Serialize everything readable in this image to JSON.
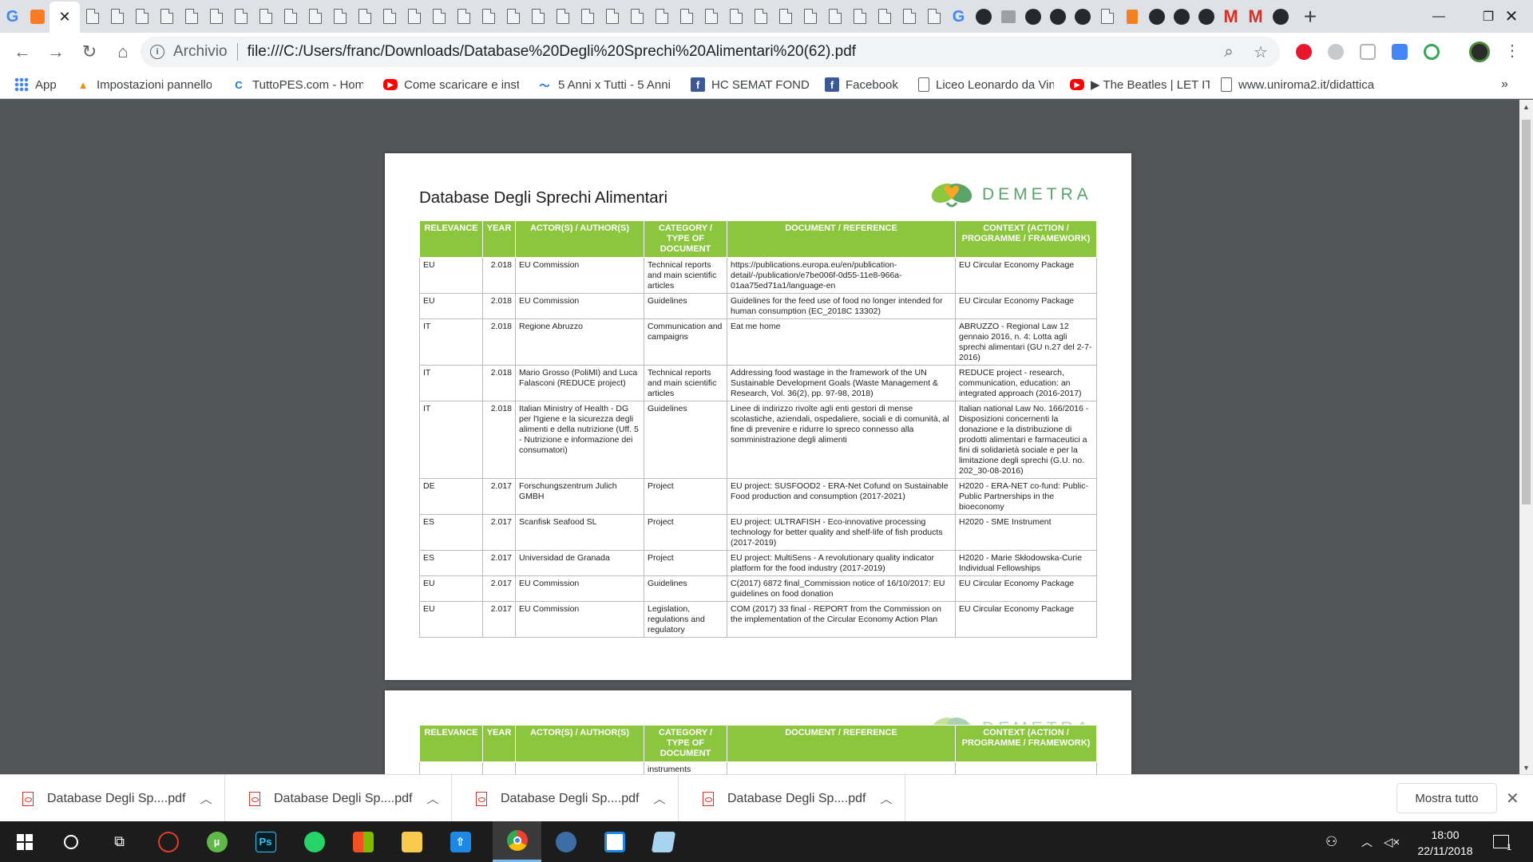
{
  "browser": {
    "address_prefix": "Archivio",
    "url": "file:///C:/Users/franc/Downloads/Database%20Degli%20Sprechi%20Alimentari%20(62).pdf",
    "tab_favicons": [
      "chrome-g-icon",
      "xampp-icon",
      "close-tab-icon",
      "file-icon",
      "github-icon",
      "gmail-icon"
    ]
  },
  "bookmarks": [
    {
      "label": "App",
      "icon": "apps-grid-icon",
      "color": "#4285f4"
    },
    {
      "label": "Impostazioni pannello",
      "icon": "aruba-icon",
      "color": "#f28b00"
    },
    {
      "label": "TuttoPES.com - Home",
      "icon": "tuttopes-icon",
      "color": "#1a73e8"
    },
    {
      "label": "Come scaricare e installare",
      "icon": "youtube-icon",
      "color": "#ff0000"
    },
    {
      "label": "5 Anni x Tutti - 5 Anni",
      "icon": "wave-icon",
      "color": "#1a73e8"
    },
    {
      "label": "HC SEMAT FONDI",
      "icon": "facebook-icon",
      "color": "#3b5998"
    },
    {
      "label": "Facebook",
      "icon": "facebook-icon",
      "color": "#3b5998"
    },
    {
      "label": "Liceo Leonardo da Vinci",
      "icon": "file-icon",
      "color": "#5f6368"
    },
    {
      "label": "▶ The Beatles | LET IT BE",
      "icon": "youtube-icon",
      "color": "#ff0000"
    },
    {
      "label": "www.uniroma2.it/didattica",
      "icon": "file-icon",
      "color": "#5f6368"
    }
  ],
  "document": {
    "title": "Database Degli Sprechi Alimentari",
    "logo_text": "DEMETRA",
    "columns": [
      "RELEVANCE",
      "YEAR",
      "ACTOR(S) / AUTHOR(S)",
      "CATEGORY / TYPE OF DOCUMENT",
      "DOCUMENT / REFERENCE",
      "CONTEXT (ACTION / PROGRAMME / FRAMEWORK)"
    ],
    "rows": [
      {
        "relevance": "EU",
        "year": "2.018",
        "actor": "EU Commission",
        "category": "Technical reports and main scientific articles",
        "document": "https://publications.europa.eu/en/publication-detail/-/publication/e7be006f-0d55-11e8-966a-01aa75ed71a1/language-en",
        "context": "EU Circular Economy Package"
      },
      {
        "relevance": "EU",
        "year": "2.018",
        "actor": "EU Commission",
        "category": "Guidelines",
        "document": "Guidelines for the feed use of food no longer intended for human consumption (EC_2018C 13302)",
        "context": "EU Circular Economy Package"
      },
      {
        "relevance": "IT",
        "year": "2.018",
        "actor": "Regione Abruzzo",
        "category": "Communication and campaigns",
        "document": "Eat me home",
        "context": "ABRUZZO - Regional Law 12 gennaio 2016, n. 4: Lotta agli sprechi alimentari (GU n.27 del 2-7-2016)"
      },
      {
        "relevance": "IT",
        "year": "2.018",
        "actor": "Mario Grosso (PoliMI) and Luca Falasconi (REDUCE project)",
        "category": "Technical reports and main scientific articles",
        "document": "Addressing food wastage in the framework of the UN Sustainable Development Goals (Waste Management & Research, Vol. 36(2), pp. 97-98, 2018)",
        "context": "REDUCE project - research, communication, education: an integrated approach (2016-2017)"
      },
      {
        "relevance": "IT",
        "year": "2.018",
        "actor": "Italian Ministry of Health - DG per l'Igiene e la sicurezza degli alimenti e della nutrizione (Uff. 5 - Nutrizione e informazione dei consumatori)",
        "category": "Guidelines",
        "document": "Linee di indirizzo rivolte agli enti gestori di mense scolastiche, aziendali, ospedaliere, sociali e di comunità, al fine di prevenire e ridurre lo spreco connesso alla somministrazione degli alimenti",
        "context": "Italian national Law No. 166/2016 - Disposizioni concernenti la donazione e la distribuzione di prodotti alimentari e farmaceutici a fini di solidarietà sociale e per la limitazione degli sprechi (G.U. no. 202_30-08-2016)"
      },
      {
        "relevance": "DE",
        "year": "2.017",
        "actor": "Forschungszentrum Julich GMBH",
        "category": "Project",
        "document": "EU project: SUSFOOD2 - ERA-Net Cofund on Sustainable Food production and consumption (2017-2021)",
        "context": "H2020 - ERA-NET co-fund: Public-Public Partnerships in the bioeconomy"
      },
      {
        "relevance": "ES",
        "year": "2.017",
        "actor": "Scanfisk Seafood SL",
        "category": "Project",
        "document": "EU project: ULTRAFISH - Eco-innovative processing technology for better quality and shelf-life of fish products (2017-2019)",
        "context": "H2020 - SME Instrument"
      },
      {
        "relevance": "ES",
        "year": "2.017",
        "actor": "Universidad de Granada",
        "category": "Project",
        "document": "EU project: MultiSens - A revolutionary quality indicator platform for the food industry (2017-2019)",
        "context": "H2020 - Marie Skłodowska-Curie Individual Fellowships"
      },
      {
        "relevance": "EU",
        "year": "2.017",
        "actor": "EU Commission",
        "category": "Guidelines",
        "document": "C(2017) 6872 final_Commission notice of 16/10/2017: EU guidelines on food donation",
        "context": "EU Circular Economy Package"
      },
      {
        "relevance": "EU",
        "year": "2.017",
        "actor": "EU Commission",
        "category": "Legislation, regulations and regulatory",
        "document": "COM (2017) 33 final - REPORT from the Commission on the implementation of the Circular Economy Action Plan",
        "context": "EU Circular Economy Package"
      }
    ],
    "page2_partial_cell": "instruments"
  },
  "downloads": {
    "items": [
      "Database Degli Sp....pdf",
      "Database Degli Sp....pdf",
      "Database Degli Sp....pdf",
      "Database Degli Sp....pdf"
    ],
    "show_all": "Mostra tutto"
  },
  "taskbar": {
    "time": "18:00",
    "date": "22/11/2018",
    "notification_count": "1"
  }
}
